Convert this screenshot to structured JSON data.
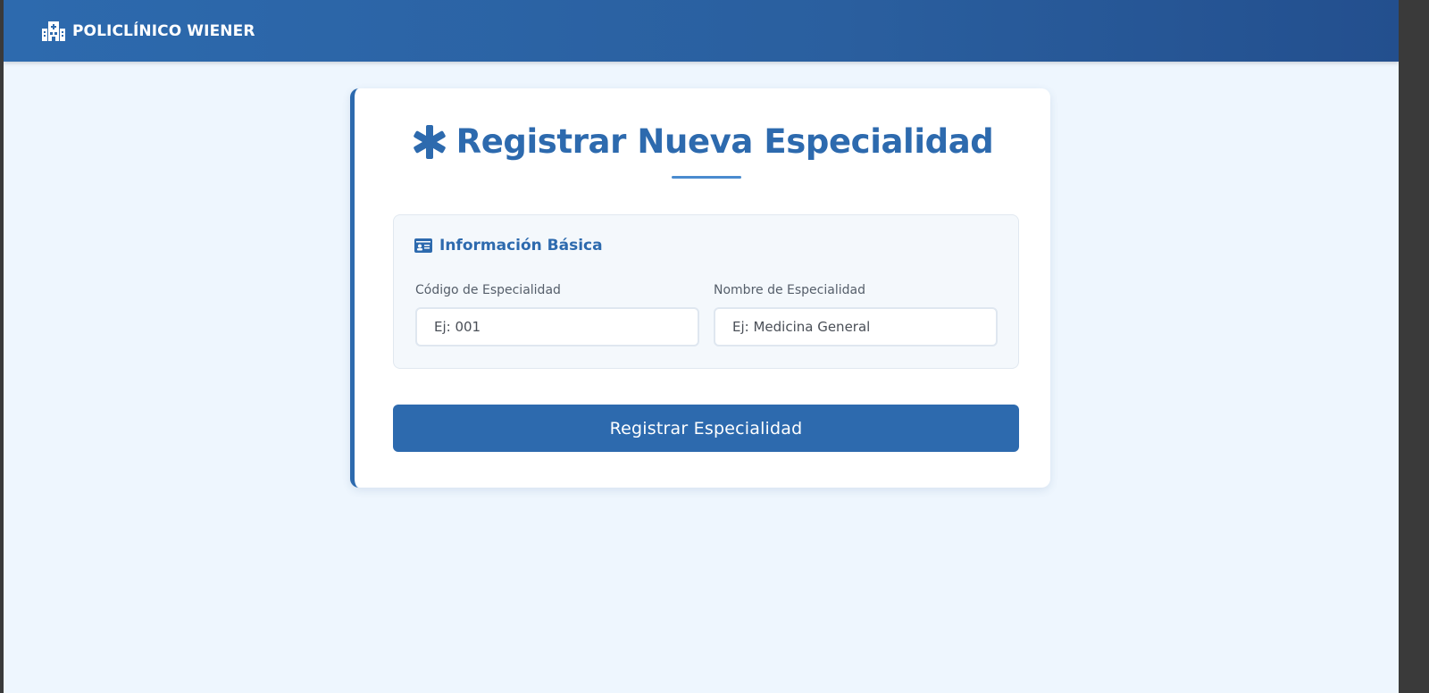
{
  "navbar": {
    "brand_name": "POLICLÍNICO WIENER",
    "brand_icon": "hospital-icon"
  },
  "form": {
    "title": "Registrar Nueva Especialidad",
    "title_icon": "asterisk-icon",
    "section": {
      "title": "Información Básica",
      "icon": "id-card-icon",
      "fields": [
        {
          "label": "Código de Especialidad",
          "placeholder": "Ej: 001",
          "value": ""
        },
        {
          "label": "Nombre de Especialidad",
          "placeholder": "Ej: Medicina General",
          "value": ""
        }
      ]
    },
    "submit_label": "Registrar Especialidad"
  },
  "colors": {
    "primary": "#2d6aae",
    "page_background": "#eef6fe",
    "card_background": "#ffffff",
    "section_background": "#f4f8fc",
    "label_text": "#555e6a"
  }
}
